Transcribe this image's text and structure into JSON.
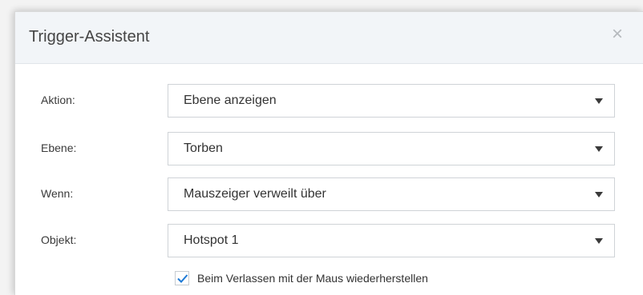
{
  "dialog": {
    "title": "Trigger-Assistent",
    "close_symbol": "×"
  },
  "fields": [
    {
      "label": "Aktion:",
      "value": "Ebene anzeigen",
      "icon": "chevron-down-icon"
    },
    {
      "label": "Ebene:",
      "value": "Torben",
      "icon": "chevron-down-icon"
    },
    {
      "label": "Wenn:",
      "value": "Mauszeiger verweilt über",
      "icon": "chevron-down-icon"
    },
    {
      "label": "Objekt:",
      "value": "Hotspot 1",
      "icon": "chevron-down-icon"
    }
  ],
  "restore_option": {
    "label": "Beim Verlassen mit der Maus wiederherstellen",
    "checked": true,
    "check_color": "#1e7ad6"
  }
}
